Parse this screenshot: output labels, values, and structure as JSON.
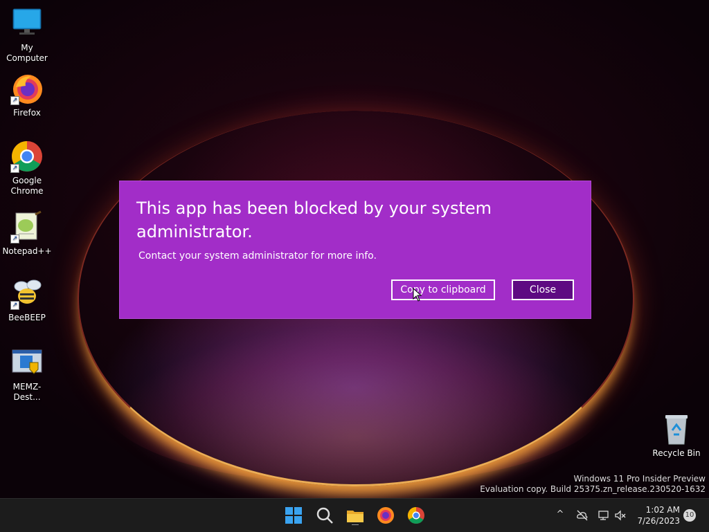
{
  "desktop": {
    "icons": [
      {
        "label": "My Computer",
        "icon": "monitor-icon"
      },
      {
        "label": "Firefox",
        "icon": "firefox-icon"
      },
      {
        "label": "Google Chrome",
        "icon": "chrome-icon"
      },
      {
        "label": "Notepad++",
        "icon": "notepadpp-icon"
      },
      {
        "label": "BeeBEEP",
        "icon": "bee-icon"
      },
      {
        "label": "MEMZ-Dest...",
        "icon": "installer-icon"
      }
    ],
    "recycle_bin": {
      "label": "Recycle Bin",
      "icon": "recycle-bin-icon"
    },
    "watermark": {
      "line1": "Windows 11 Pro Insider Preview",
      "line2": "Evaluation copy. Build 25375.zn_release.230520-1632"
    }
  },
  "dialog": {
    "title": "This app has been blocked by your system administrator.",
    "message": "Contact your system administrator for more info.",
    "copy_button": "Copy to clipboard",
    "close_button": "Close",
    "colors": {
      "background": "#a22dc8",
      "close_button": "#5e0a82"
    }
  },
  "taskbar": {
    "pinned": [
      {
        "name": "start",
        "icon": "windows-start-icon"
      },
      {
        "name": "search",
        "icon": "search-icon"
      },
      {
        "name": "file-explorer",
        "icon": "folder-icon"
      },
      {
        "name": "firefox",
        "icon": "firefox-icon"
      },
      {
        "name": "chrome",
        "icon": "chrome-icon"
      }
    ],
    "tray": {
      "chevron": "^",
      "time": "1:02 AM",
      "date": "7/26/2023",
      "notification_count": "10"
    }
  }
}
